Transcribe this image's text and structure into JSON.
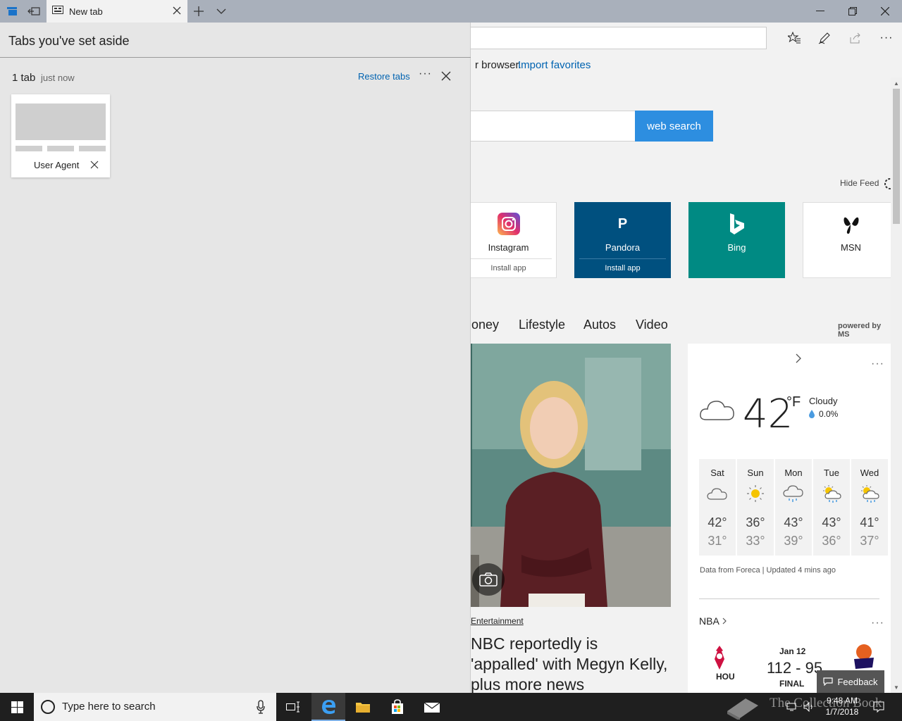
{
  "browser": {
    "tab_title": "New tab",
    "favorites_bar": {
      "text": "r browser.",
      "link": "Import favorites"
    }
  },
  "new_tab_page": {
    "search_button": "web search",
    "hide_feed": "Hide Feed",
    "tiles": [
      {
        "name": "Instagram",
        "sub": "Install app",
        "bg": "#ffffff",
        "fg": "#222222"
      },
      {
        "name": "Pandora",
        "sub": "Install app",
        "bg": "#00507f",
        "fg": "#ffffff"
      },
      {
        "name": "Bing",
        "sub": "",
        "bg": "#008a83",
        "fg": "#ffffff"
      },
      {
        "name": "MSN",
        "sub": "",
        "bg": "#ffffff",
        "fg": "#222222"
      }
    ],
    "categories": [
      "oney",
      "Lifestyle",
      "Autos",
      "Video"
    ],
    "powered_by": "powered by MS",
    "story": {
      "category": "Entertainment",
      "headline": "NBC reportedly is 'appalled' with Megyn Kelly, plus more news"
    },
    "weather": {
      "temp": "42",
      "unit": "°F",
      "condition": "Cloudy",
      "precip": "0.0%",
      "forecast": [
        {
          "day": "Sat",
          "hi": "42°",
          "lo": "31°",
          "icon": "cloudy-icon"
        },
        {
          "day": "Sun",
          "hi": "36°",
          "lo": "33°",
          "icon": "sunny-icon"
        },
        {
          "day": "Mon",
          "hi": "43°",
          "lo": "39°",
          "icon": "rain-icon"
        },
        {
          "day": "Tue",
          "hi": "43°",
          "lo": "36°",
          "icon": "sun-rain-icon"
        },
        {
          "day": "Wed",
          "hi": "41°",
          "lo": "37°",
          "icon": "sun-rain-icon"
        }
      ],
      "source": "Data from Foreca | Updated 4 mins ago"
    },
    "nba": {
      "title": "NBA",
      "team": "HOU",
      "date": "Jan 12",
      "score": "112 - 95",
      "status": "FINAL"
    },
    "feedback": "Feedback"
  },
  "aside_panel": {
    "title": "Tabs you've set aside",
    "group_count": "1 tab",
    "group_time": "just now",
    "restore": "Restore tabs",
    "more": "···",
    "tab_label": "User Agent"
  },
  "taskbar": {
    "search_placeholder": "Type here to search",
    "time": "9:48 AM",
    "date": "1/7/2018",
    "watermark": "The Collection Book"
  },
  "colors": {
    "accent": "#2d8ee0",
    "link": "#0063b1"
  }
}
